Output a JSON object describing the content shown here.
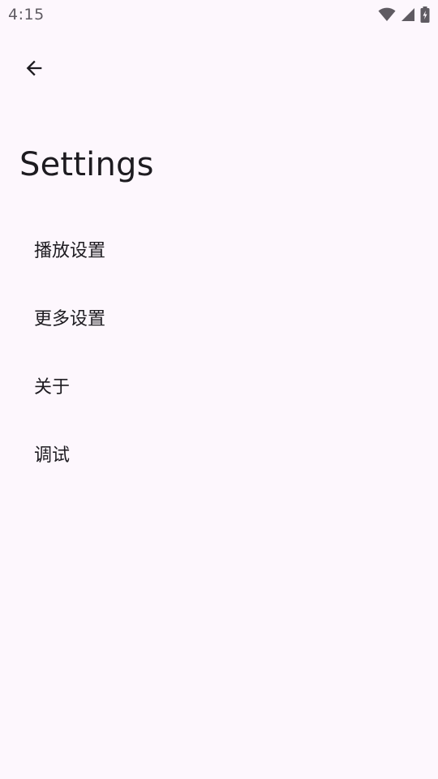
{
  "status_bar": {
    "time": "4:15",
    "icons": [
      "wifi-icon",
      "cellular-signal-icon",
      "battery-charging-icon"
    ]
  },
  "header": {
    "back_icon": "arrow-left-icon"
  },
  "page": {
    "title": "Settings"
  },
  "settings": {
    "items": [
      {
        "label": "播放设置"
      },
      {
        "label": "更多设置"
      },
      {
        "label": "关于"
      },
      {
        "label": "调试"
      }
    ]
  },
  "colors": {
    "background": "#fdf7fd",
    "text": "#1d1b20",
    "status_text": "#5f5b62"
  }
}
